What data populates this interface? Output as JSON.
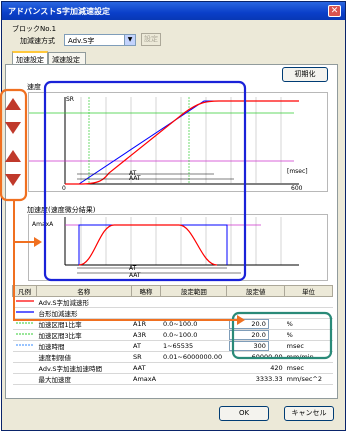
{
  "window": {
    "title": "アドバンストS字加減速設定"
  },
  "block": {
    "label": "ブロックNo.1"
  },
  "accel_method": {
    "label": "加減速方式",
    "selected": "Adv.S字",
    "set_button": "設定"
  },
  "tabs": [
    {
      "label": "加速設定"
    },
    {
      "label": "減速設定"
    }
  ],
  "init_button": "初期化",
  "speed_graph": {
    "title": "速度",
    "y_marker": "SR",
    "x_start": "0",
    "x_end": "600",
    "x_unit": "[msec]",
    "at_label": "AT",
    "aat_label": "AAT"
  },
  "accel_graph": {
    "title": "加速度(速度微分結果)",
    "y_marker": "AmaxA",
    "at_label": "AT",
    "aat_label": "AAT"
  },
  "table": {
    "headers": [
      "凡例",
      "名称",
      "略称",
      "設定範囲",
      "設定値",
      "単位"
    ],
    "rows": [
      {
        "name": "Adv.S字加減速形",
        "abbr": "",
        "range": "",
        "value": "",
        "unit": "",
        "legend": "red-line"
      },
      {
        "name": "台形加減速形",
        "abbr": "",
        "range": "",
        "value": "",
        "unit": "",
        "legend": "blue-line"
      },
      {
        "name": "加速区間1比率",
        "abbr": "A1R",
        "range": "0.0~100.0",
        "value": "20.0",
        "unit": "%",
        "legend": "green-dash"
      },
      {
        "name": "加速区間3比率",
        "abbr": "A3R",
        "range": "0.0~100.0",
        "value": "20.0",
        "unit": "%",
        "legend": "green-dash"
      },
      {
        "name": "加速時間",
        "abbr": "AT",
        "range": "1~65535",
        "value": "300",
        "unit": "msec",
        "legend": "blue-dash"
      },
      {
        "name": "速度制限値",
        "abbr": "SR",
        "range": "0.01~6000000.00",
        "value": "60000.00",
        "unit": "mm/min",
        "legend": ""
      },
      {
        "name": "Adv.S字加速加速時間",
        "abbr": "AAT",
        "range": "",
        "value": "420",
        "unit": "msec",
        "legend": ""
      },
      {
        "name": "最大加速度",
        "abbr": "AmaxA",
        "range": "",
        "value": "3333.33",
        "unit": "mm/sec^2",
        "legend": ""
      }
    ]
  },
  "buttons": {
    "ok": "OK",
    "cancel": "キャンセル"
  },
  "colors": {
    "adv_curve": "#ff0000",
    "trap_curve": "#0000ff",
    "annotation_blue": "#1a22d8",
    "annotation_orange": "#f07020",
    "annotation_teal": "#2a8a78"
  }
}
